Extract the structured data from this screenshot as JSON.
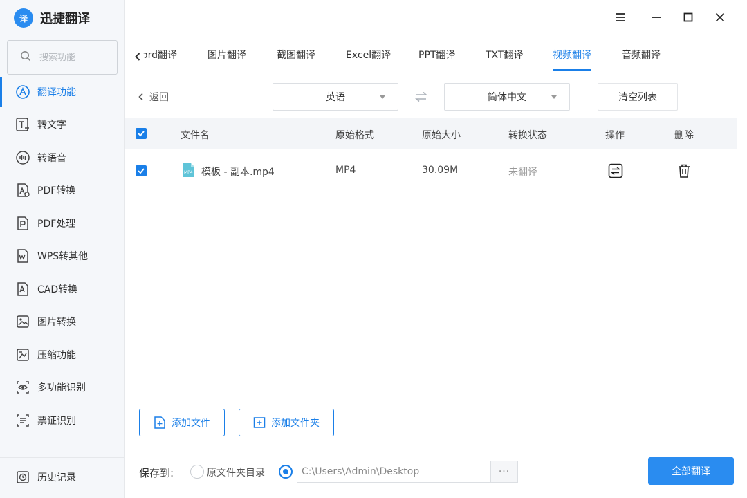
{
  "app": {
    "name": "迅捷翻译",
    "logo_char": "译"
  },
  "search": {
    "placeholder": "搜索功能"
  },
  "sidebar": {
    "items": [
      {
        "label": "翻译功能",
        "icon": "translate-a-icon"
      },
      {
        "label": "转文字",
        "icon": "text-convert-icon"
      },
      {
        "label": "转语音",
        "icon": "voice-icon"
      },
      {
        "label": "PDF转换",
        "icon": "pdf-convert-icon"
      },
      {
        "label": "PDF处理",
        "icon": "pdf-process-icon"
      },
      {
        "label": "WPS转其他",
        "icon": "wps-icon"
      },
      {
        "label": "CAD转换",
        "icon": "cad-icon"
      },
      {
        "label": "图片转换",
        "icon": "image-convert-icon"
      },
      {
        "label": "压缩功能",
        "icon": "compress-icon"
      },
      {
        "label": "多功能识别",
        "icon": "eye-icon"
      },
      {
        "label": "票证识别",
        "icon": "ticket-icon"
      }
    ],
    "history": {
      "label": "历史记录",
      "icon": "history-icon"
    }
  },
  "tabs": [
    {
      "label": "ord翻译"
    },
    {
      "label": "图片翻译"
    },
    {
      "label": "截图翻译"
    },
    {
      "label": "Excel翻译"
    },
    {
      "label": "PPT翻译"
    },
    {
      "label": "TXT翻译"
    },
    {
      "label": "视频翻译"
    },
    {
      "label": "音频翻译"
    }
  ],
  "toolbar": {
    "back_label": "返回",
    "source_lang": "英语",
    "target_lang": "简体中文",
    "clear_label": "清空列表"
  },
  "table": {
    "headers": {
      "filename": "文件名",
      "format": "原始格式",
      "size": "原始大小",
      "status": "转换状态",
      "action": "操作",
      "delete": "删除"
    },
    "rows": [
      {
        "filename": "模板 - 副本.mp4",
        "format": "MP4",
        "size": "30.09M",
        "status": "未翻译",
        "file_badge": "MP4"
      }
    ]
  },
  "add": {
    "file_label": "添加文件",
    "folder_label": "添加文件夹"
  },
  "footer": {
    "save_label": "保存到:",
    "option_original": "原文件夹目录",
    "path_value": "C:\\Users\\Admin\\Desktop",
    "more": "···",
    "translate_all": "全部翻译"
  },
  "colors": {
    "accent": "#1a7fe8",
    "button_primary": "#2a8cf0"
  }
}
